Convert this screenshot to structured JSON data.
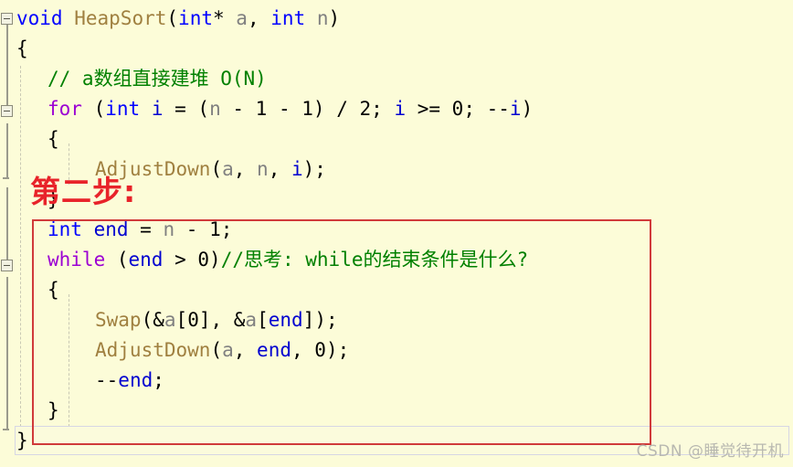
{
  "editor": {
    "background_color": "#fcfcd8",
    "font_size_px": 21,
    "line_height_px": 33,
    "language": "C"
  },
  "colors": {
    "background": "#fcfcd8",
    "keyword": "#9b00d3",
    "type": "#0000ff",
    "function": "#a08040",
    "variable": "#0000d0",
    "parameter": "#808080",
    "comment": "#008000",
    "punctuation": "#000000",
    "annotation_red": "#e8232a",
    "box_red": "#d03a3a",
    "watermark": "#b8b8b0",
    "gutter_line": "#9a9a8c",
    "indent_guide": "#c9c9b4",
    "current_line_border": "#d6d6e4"
  },
  "code_lines": [
    {
      "index": 0,
      "indent": 0,
      "tokens": [
        {
          "t": "void",
          "c": "type"
        },
        {
          "t": " ",
          "c": "punc"
        },
        {
          "t": "HeapSort",
          "c": "fn"
        },
        {
          "t": "(",
          "c": "punc"
        },
        {
          "t": "int",
          "c": "type"
        },
        {
          "t": "* ",
          "c": "punc"
        },
        {
          "t": "a",
          "c": "param"
        },
        {
          "t": ", ",
          "c": "punc"
        },
        {
          "t": "int",
          "c": "type"
        },
        {
          "t": " ",
          "c": "punc"
        },
        {
          "t": "n",
          "c": "param"
        },
        {
          "t": ")",
          "c": "punc"
        }
      ]
    },
    {
      "index": 1,
      "indent": 0,
      "tokens": [
        {
          "t": "{",
          "c": "brace"
        }
      ]
    },
    {
      "index": 2,
      "indent": 1,
      "tokens": [
        {
          "t": "// a数组直接建堆 O(N)",
          "c": "cmt"
        }
      ]
    },
    {
      "index": 3,
      "indent": 1,
      "tokens": [
        {
          "t": "for",
          "c": "kw"
        },
        {
          "t": " (",
          "c": "punc"
        },
        {
          "t": "int",
          "c": "type"
        },
        {
          "t": " ",
          "c": "punc"
        },
        {
          "t": "i",
          "c": "var"
        },
        {
          "t": " = (",
          "c": "punc"
        },
        {
          "t": "n",
          "c": "param"
        },
        {
          "t": " - ",
          "c": "punc"
        },
        {
          "t": "1",
          "c": "num"
        },
        {
          "t": " - ",
          "c": "punc"
        },
        {
          "t": "1",
          "c": "num"
        },
        {
          "t": ") / ",
          "c": "punc"
        },
        {
          "t": "2",
          "c": "num"
        },
        {
          "t": "; ",
          "c": "punc"
        },
        {
          "t": "i",
          "c": "var"
        },
        {
          "t": " >= ",
          "c": "punc"
        },
        {
          "t": "0",
          "c": "num"
        },
        {
          "t": "; --",
          "c": "punc"
        },
        {
          "t": "i",
          "c": "var"
        },
        {
          "t": ")",
          "c": "punc"
        }
      ]
    },
    {
      "index": 4,
      "indent": 1,
      "tokens": [
        {
          "t": "{",
          "c": "brace"
        }
      ]
    },
    {
      "index": 5,
      "indent": 2,
      "tokens": [
        {
          "t": "AdjustDown",
          "c": "fn"
        },
        {
          "t": "(",
          "c": "punc"
        },
        {
          "t": "a",
          "c": "param"
        },
        {
          "t": ", ",
          "c": "punc"
        },
        {
          "t": "n",
          "c": "param"
        },
        {
          "t": ", ",
          "c": "punc"
        },
        {
          "t": "i",
          "c": "var"
        },
        {
          "t": ");",
          "c": "punc"
        }
      ]
    },
    {
      "index": 6,
      "indent": 1,
      "tokens": [
        {
          "t": "}",
          "c": "brace"
        }
      ]
    },
    {
      "index": 7,
      "indent": 1,
      "tokens": [
        {
          "t": "int",
          "c": "type"
        },
        {
          "t": " ",
          "c": "punc"
        },
        {
          "t": "end",
          "c": "var"
        },
        {
          "t": " = ",
          "c": "punc"
        },
        {
          "t": "n",
          "c": "param"
        },
        {
          "t": " - ",
          "c": "punc"
        },
        {
          "t": "1",
          "c": "num"
        },
        {
          "t": ";",
          "c": "punc"
        }
      ]
    },
    {
      "index": 8,
      "indent": 1,
      "tokens": [
        {
          "t": "while",
          "c": "kw"
        },
        {
          "t": " (",
          "c": "punc"
        },
        {
          "t": "end",
          "c": "var"
        },
        {
          "t": " > ",
          "c": "punc"
        },
        {
          "t": "0",
          "c": "num"
        },
        {
          "t": ")",
          "c": "punc"
        },
        {
          "t": "//思考: while的结束条件是什么?",
          "c": "cmt"
        }
      ]
    },
    {
      "index": 9,
      "indent": 1,
      "tokens": [
        {
          "t": "{",
          "c": "brace"
        }
      ]
    },
    {
      "index": 10,
      "indent": 2,
      "tokens": [
        {
          "t": "Swap",
          "c": "fn"
        },
        {
          "t": "(&",
          "c": "punc"
        },
        {
          "t": "a",
          "c": "param"
        },
        {
          "t": "[",
          "c": "punc"
        },
        {
          "t": "0",
          "c": "num"
        },
        {
          "t": "], &",
          "c": "punc"
        },
        {
          "t": "a",
          "c": "param"
        },
        {
          "t": "[",
          "c": "punc"
        },
        {
          "t": "end",
          "c": "var"
        },
        {
          "t": "]);",
          "c": "punc"
        }
      ]
    },
    {
      "index": 11,
      "indent": 2,
      "tokens": [
        {
          "t": "AdjustDown",
          "c": "fn"
        },
        {
          "t": "(",
          "c": "punc"
        },
        {
          "t": "a",
          "c": "param"
        },
        {
          "t": ", ",
          "c": "punc"
        },
        {
          "t": "end",
          "c": "var"
        },
        {
          "t": ", ",
          "c": "punc"
        },
        {
          "t": "0",
          "c": "num"
        },
        {
          "t": ");",
          "c": "punc"
        }
      ]
    },
    {
      "index": 12,
      "indent": 2,
      "tokens": [
        {
          "t": "--",
          "c": "punc"
        },
        {
          "t": "end",
          "c": "var"
        },
        {
          "t": ";",
          "c": "punc"
        }
      ]
    },
    {
      "index": 13,
      "indent": 1,
      "tokens": [
        {
          "t": "}",
          "c": "brace"
        }
      ]
    },
    {
      "index": 14,
      "indent": 0,
      "tokens": [
        {
          "t": "}",
          "c": "brace"
        }
      ]
    }
  ],
  "code_plain": [
    "void HeapSort(int* a, int n)",
    "{",
    "    // a数组直接建堆 O(N)",
    "    for (int i = (n - 1 - 1) / 2; i >= 0; --i)",
    "    {",
    "        AdjustDown(a, n, i);",
    "    }",
    "    int end = n - 1;",
    "    while (end > 0)//思考: while的结束条件是什么?",
    "    {",
    "        Swap(&a[0], &a[end]);",
    "        AdjustDown(a, end, 0);",
    "        --end;",
    "    }",
    "}"
  ],
  "annotation": {
    "text": "第二步:",
    "color": "#e8232a"
  },
  "watermark": {
    "text": "CSDN @睡觉待开机"
  },
  "gutter": {
    "fold_markers": [
      "collapse-minus",
      "collapse-minus",
      "collapse-minus"
    ],
    "fold_marker_glyph": "−"
  }
}
